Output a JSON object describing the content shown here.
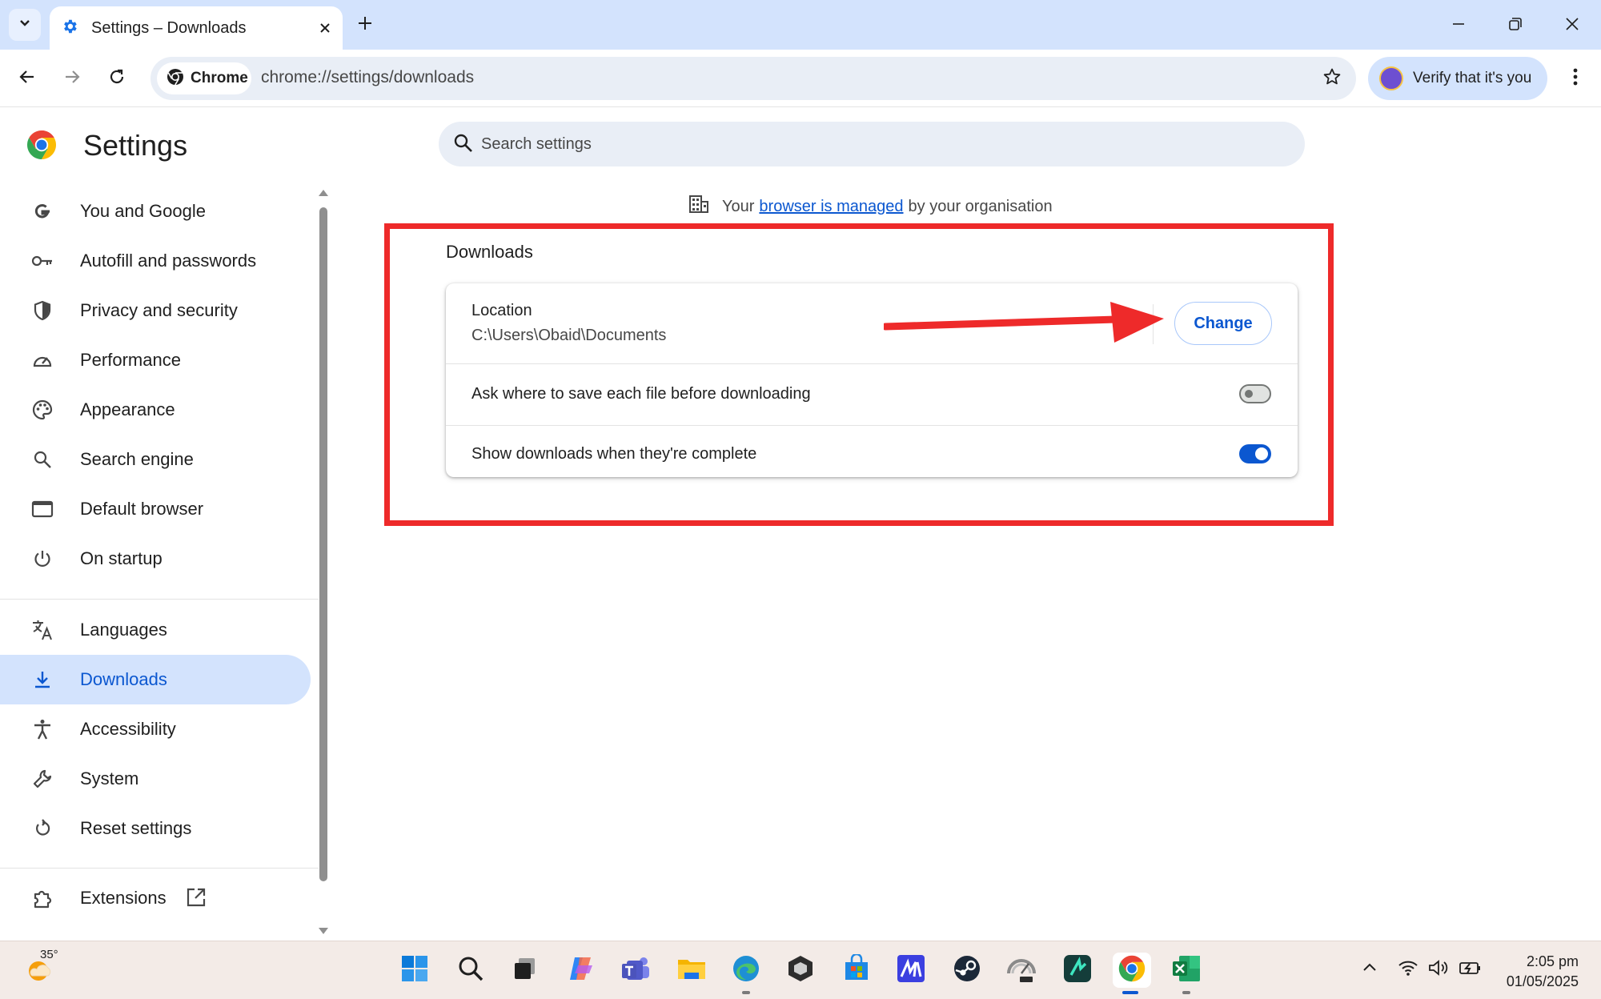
{
  "tab": {
    "title": "Settings – Downloads"
  },
  "toolbar": {
    "chip_label": "Chrome",
    "url": "chrome://settings/downloads",
    "verify_label": "Verify that it's you"
  },
  "page": {
    "title": "Settings",
    "search_placeholder": "Search settings"
  },
  "sidebar": {
    "items": [
      {
        "label": "You and Google",
        "icon": "google-g-icon"
      },
      {
        "label": "Autofill and passwords",
        "icon": "key-icon"
      },
      {
        "label": "Privacy and security",
        "icon": "shield-icon"
      },
      {
        "label": "Performance",
        "icon": "speedometer-icon"
      },
      {
        "label": "Appearance",
        "icon": "palette-icon"
      },
      {
        "label": "Search engine",
        "icon": "search-icon"
      },
      {
        "label": "Default browser",
        "icon": "browser-window-icon"
      },
      {
        "label": "On startup",
        "icon": "power-icon"
      },
      {
        "label": "Languages",
        "icon": "translate-icon"
      },
      {
        "label": "Downloads",
        "icon": "download-icon",
        "active": true
      },
      {
        "label": "Accessibility",
        "icon": "accessibility-icon"
      },
      {
        "label": "System",
        "icon": "wrench-icon"
      },
      {
        "label": "Reset settings",
        "icon": "reset-icon"
      },
      {
        "label": "Extensions",
        "icon": "puzzle-icon"
      }
    ]
  },
  "managed": {
    "prefix": "Your",
    "link": "browser is managed",
    "suffix": "by your organisation"
  },
  "downloads": {
    "section_title": "Downloads",
    "location_label": "Location",
    "location_path": "C:\\Users\\Obaid\\Documents",
    "change_label": "Change",
    "ask_label": "Ask where to save each file before downloading",
    "ask_enabled": false,
    "show_label": "Show downloads when they're complete",
    "show_enabled": true
  },
  "taskbar": {
    "weather_temp": "35°",
    "time": "2:05 pm",
    "date": "01/05/2025"
  },
  "colors": {
    "accent": "#0b57d0",
    "highlight": "#ee2a2a",
    "tabstrip": "#d3e3fd"
  }
}
